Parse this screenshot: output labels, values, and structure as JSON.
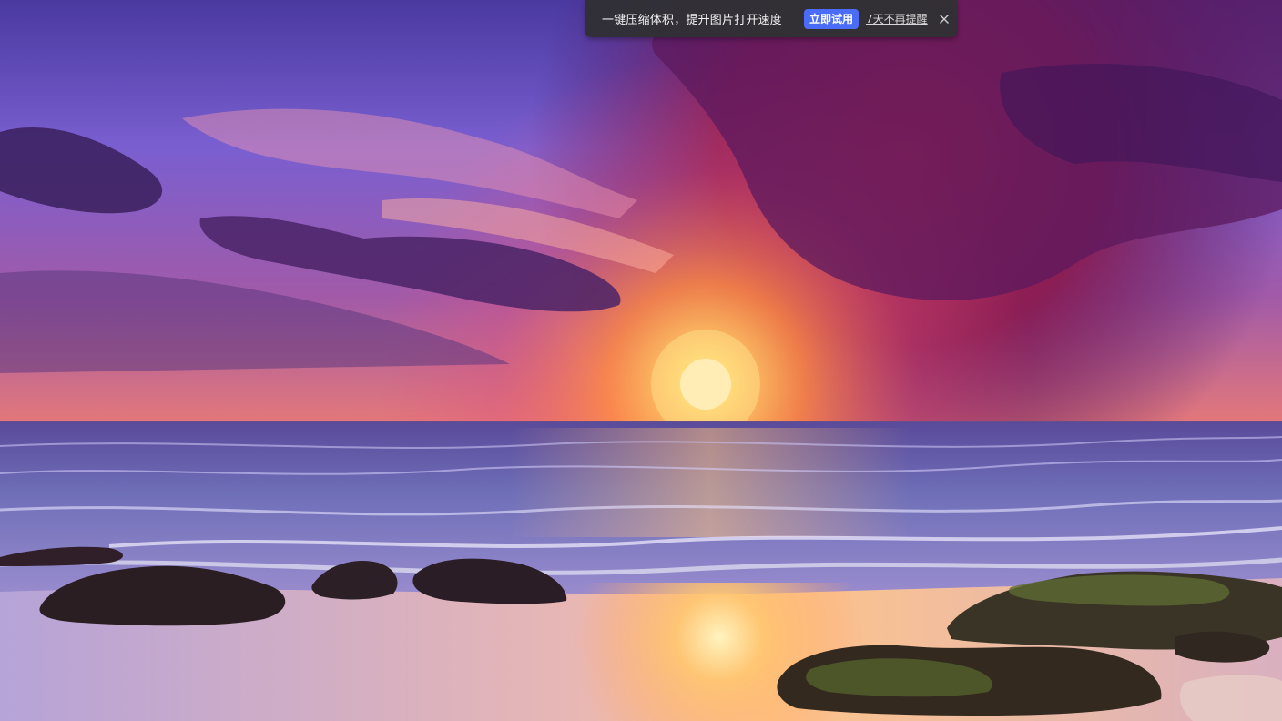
{
  "toast": {
    "message": "一键压缩体积，提升图片打开速度",
    "try_label": "立即试用",
    "dismiss_label": "7天不再提醒",
    "close_icon": "close-icon"
  },
  "colors": {
    "toast_bg": "#303034",
    "button_accent": "#4a6cf7"
  }
}
